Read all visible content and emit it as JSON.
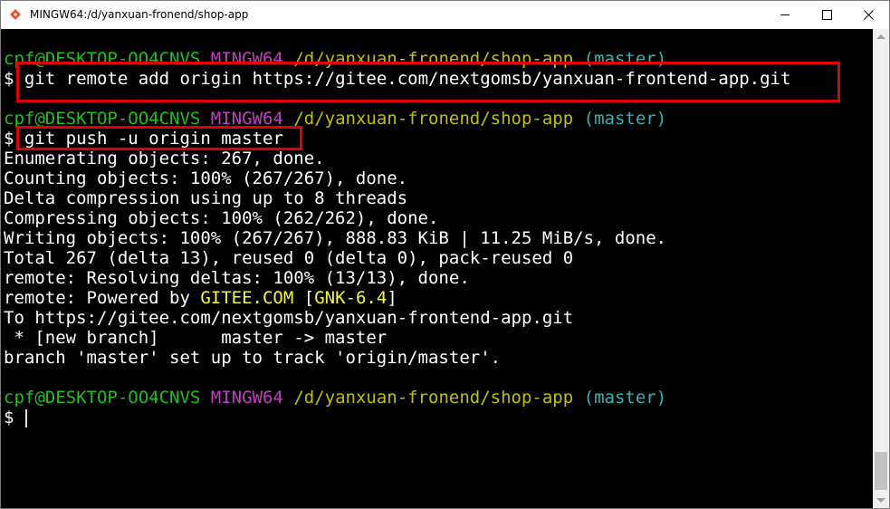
{
  "window": {
    "title": "MINGW64:/d/yanxuan-fronend/shop-app",
    "controls": [
      "minimize-icon",
      "maximize-icon",
      "close-icon"
    ]
  },
  "prompt": {
    "user_host": "cpf@DESKTOP-OO4CNVS",
    "system": "MINGW64",
    "path": "/d/yanxuan-fronend/shop-app",
    "branch": "(master)",
    "symbol": "$"
  },
  "commands": {
    "remote_add": "git remote add origin https://gitee.com/nextgomsb/yanxuan-frontend-app.git",
    "push": "git push -u origin master"
  },
  "output": {
    "l1": "Enumerating objects: 267, done.",
    "l2": "Counting objects: 100% (267/267), done.",
    "l3": "Delta compression using up to 8 threads",
    "l4": "Compressing objects: 100% (262/262), done.",
    "l5": "Writing objects: 100% (267/267), 888.83 KiB | 11.25 MiB/s, done.",
    "l6": "Total 267 (delta 13), reused 0 (delta 0), pack-reused 0",
    "l7": "remote: Resolving deltas: 100% (13/13), done.",
    "l8_prefix": "remote: Powered by ",
    "l8_gitee": "GITEE.COM",
    "l8_open": " [",
    "l8_gnk": "GNK-6.4",
    "l8_close": "]",
    "l9": "To https://gitee.com/nextgomsb/yanxuan-frontend-app.git",
    "l10": " * [new branch]      master -> master",
    "l11": "branch 'master' set up to track 'origin/master'."
  },
  "colors": {
    "user_host": "#1fbf1f",
    "system": "#c040c0",
    "path": "#c0c000",
    "branch": "#2ab7b7",
    "highlight_box": "#e00000"
  }
}
